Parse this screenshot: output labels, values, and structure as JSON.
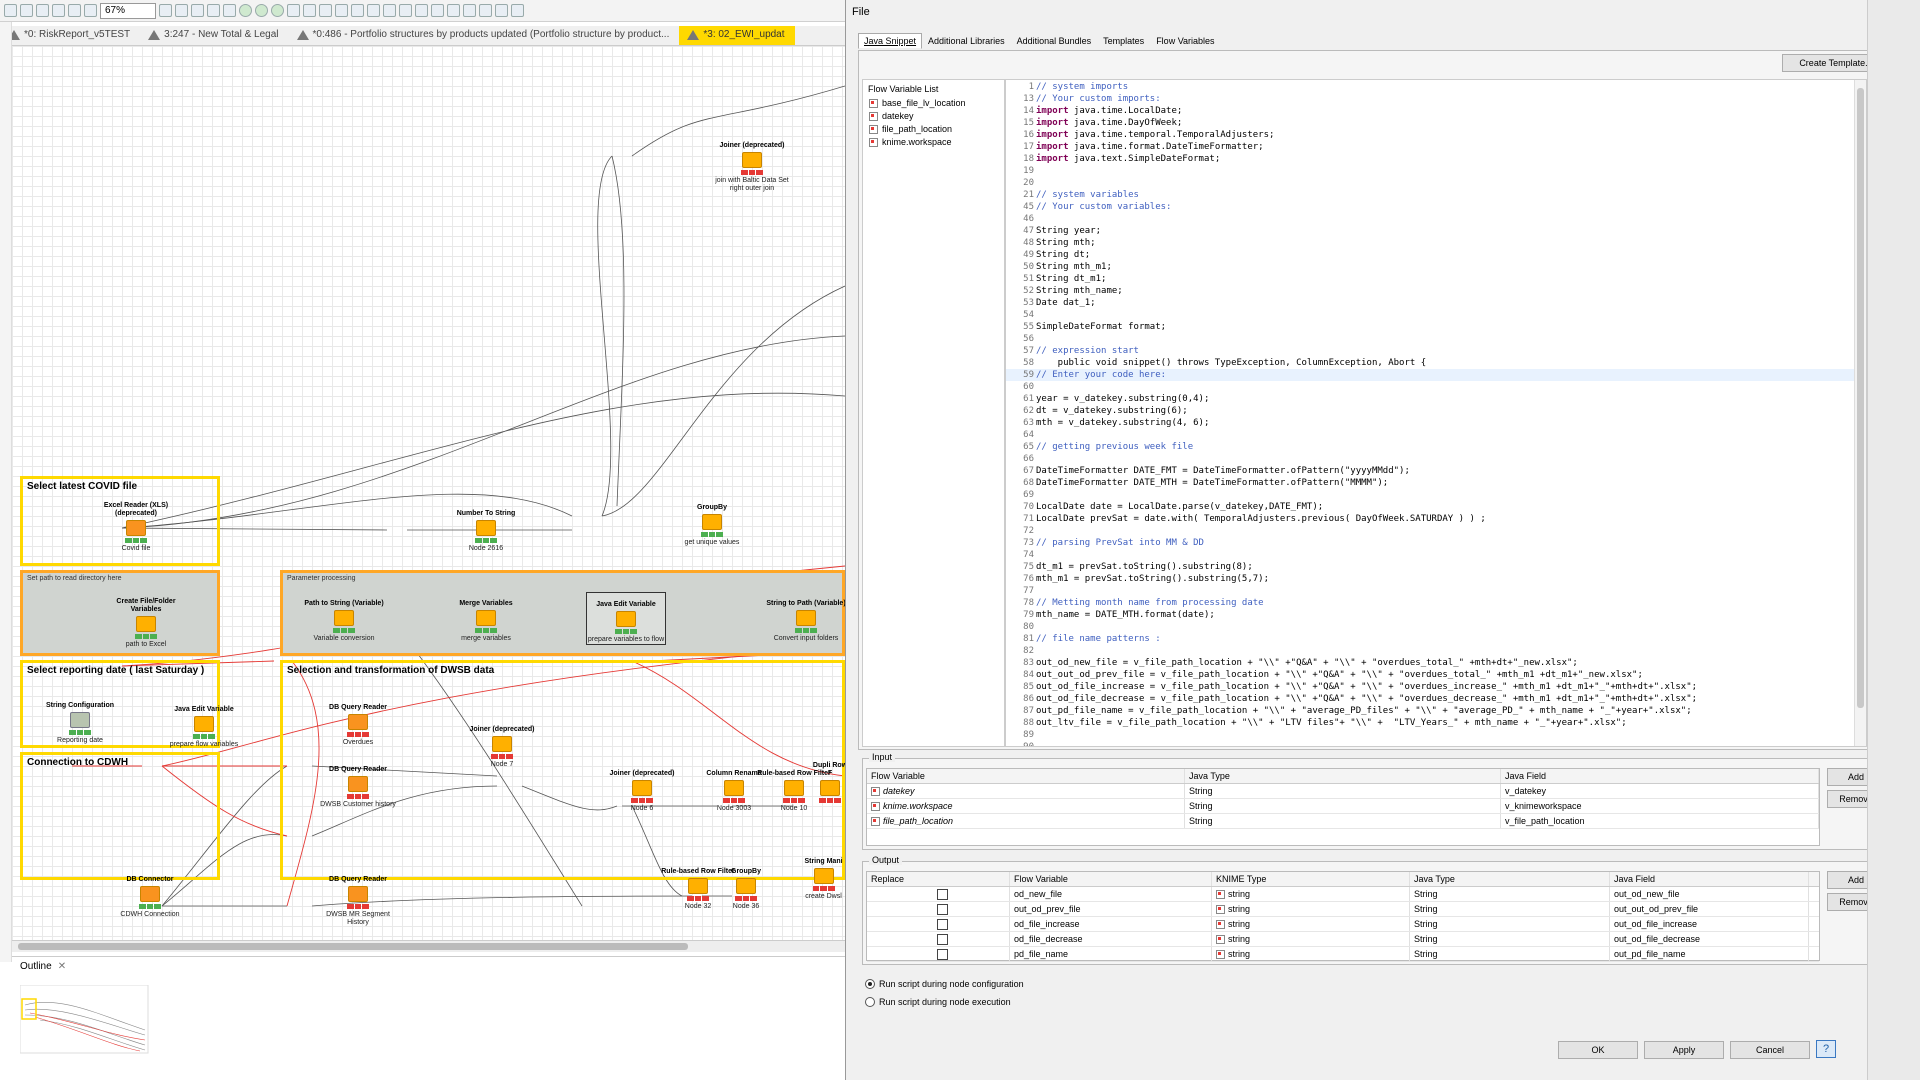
{
  "toolbar": {
    "zoom": "67%"
  },
  "editor_tabs": [
    {
      "label": "*0: RiskReport_v5TEST",
      "active": false
    },
    {
      "label": "3:247 - New Total & Legal",
      "active": false
    },
    {
      "label": "*0:486 - Portfolio structures by products updated (Portfolio structure by product...",
      "active": false
    },
    {
      "label": "*3: 02_EWI_updat",
      "active": true
    }
  ],
  "annotations": {
    "covid": "Select latest COVID file",
    "dir": "Set path to read directory here",
    "param": "Parameter processing",
    "reporting": "Select reporting date ( last Saturday )",
    "selection": "Selection and transformation of DWSB data",
    "cdwh": "Connection to CDWH"
  },
  "nodes": [
    {
      "id": "joiner-top",
      "title": "Joiner (deprecated)",
      "label": "join with Baltic Data Set right outer join"
    },
    {
      "id": "excel-reader",
      "title": "Excel Reader (XLS) (deprecated)",
      "label": "Covid file"
    },
    {
      "id": "number-to-string",
      "title": "Number To String",
      "label": "Node 2616"
    },
    {
      "id": "groupby-top",
      "title": "GroupBy",
      "label": "get unique values"
    },
    {
      "id": "create-file-folder",
      "title": "Create File/Folder Variables",
      "label": "path to Excel"
    },
    {
      "id": "path-to-string",
      "title": "Path to String (Variable)",
      "label": "Variable conversion"
    },
    {
      "id": "merge-variables",
      "title": "Merge Variables",
      "label": "merge variables"
    },
    {
      "id": "java-edit-var-top",
      "title": "Java Edit Variable",
      "label": "prepare variables to flow"
    },
    {
      "id": "string-to-path",
      "title": "String to Path (Variable)",
      "label": "Convert input folders"
    },
    {
      "id": "string-config",
      "title": "String Configuration",
      "label": "Reporting date"
    },
    {
      "id": "java-edit-var-left",
      "title": "Java Edit Variable",
      "label": "prepare flow variables"
    },
    {
      "id": "db-query-1",
      "title": "DB Query Reader",
      "label": "Overdues"
    },
    {
      "id": "joiner-mid",
      "title": "Joiner (deprecated)",
      "label": "Node 7"
    },
    {
      "id": "db-query-2",
      "title": "DB Query Reader",
      "label": "DWSB Customer history"
    },
    {
      "id": "joiner-right",
      "title": "Joiner (deprecated)",
      "label": "Node 6"
    },
    {
      "id": "column-rename",
      "title": "Column Rename",
      "label": "Node 3003"
    },
    {
      "id": "rule-row-filter",
      "title": "Rule-based Row Filter",
      "label": "Node 10"
    },
    {
      "id": "dupl",
      "title": "Dupli Row F",
      "label": ""
    },
    {
      "id": "db-connector",
      "title": "DB Connector",
      "label": "CDWH Connection"
    },
    {
      "id": "db-query-3",
      "title": "DB Query Reader",
      "label": "DWSB MR Segment History"
    },
    {
      "id": "rule-row-filter-2",
      "title": "Rule-based Row Filter",
      "label": "Node 32"
    },
    {
      "id": "groupby-bottom",
      "title": "GroupBy",
      "label": "Node 36"
    },
    {
      "id": "string-manip",
      "title": "String Mani",
      "label": "create Dwsl"
    }
  ],
  "outline": {
    "label": "Outline"
  },
  "dialog": {
    "title": "File",
    "tabs": [
      "Java Snippet",
      "Additional Libraries",
      "Additional Bundles",
      "Templates",
      "Flow Variables"
    ],
    "create_template": "Create Template...",
    "flow_variable_list": {
      "header": "Flow Variable List",
      "items": [
        "base_file_lv_location",
        "datekey",
        "file_path_location",
        "knime.workspace"
      ]
    },
    "code_lines": [
      {
        "n": "1",
        "t": "// system imports",
        "k": "cm",
        "fold": true
      },
      {
        "n": "13",
        "t": "// Your custom imports:",
        "k": "cm"
      },
      {
        "n": "14",
        "t": "import java.time.LocalDate;",
        "k": "imp"
      },
      {
        "n": "15",
        "t": "import java.time.DayOfWeek;",
        "k": "imp"
      },
      {
        "n": "16",
        "t": "import java.time.temporal.TemporalAdjusters;",
        "k": "imp"
      },
      {
        "n": "17",
        "t": "import java.time.format.DateTimeFormatter;",
        "k": "imp"
      },
      {
        "n": "18",
        "t": "import java.text.SimpleDateFormat;",
        "k": "imp"
      },
      {
        "n": "19",
        "t": "",
        "k": ""
      },
      {
        "n": "20",
        "t": "",
        "k": ""
      },
      {
        "n": "21",
        "t": "// system variables",
        "k": "cm",
        "fold": true
      },
      {
        "n": "45",
        "t": "// Your custom variables:",
        "k": "cm"
      },
      {
        "n": "46",
        "t": "",
        "k": ""
      },
      {
        "n": "47",
        "t": "String year;",
        "k": ""
      },
      {
        "n": "48",
        "t": "String mth;",
        "k": ""
      },
      {
        "n": "49",
        "t": "String dt;",
        "k": ""
      },
      {
        "n": "50",
        "t": "String mth_m1;",
        "k": ""
      },
      {
        "n": "51",
        "t": "String dt_m1;",
        "k": ""
      },
      {
        "n": "52",
        "t": "String mth_name;",
        "k": ""
      },
      {
        "n": "53",
        "t": "Date dat_1;",
        "k": ""
      },
      {
        "n": "54",
        "t": "",
        "k": ""
      },
      {
        "n": "55",
        "t": "SimpleDateFormat format;",
        "k": ""
      },
      {
        "n": "56",
        "t": "",
        "k": ""
      },
      {
        "n": "57",
        "t": "// expression start",
        "k": "cm",
        "fold": true
      },
      {
        "n": "58",
        "t": "    public void snippet() throws TypeException, ColumnException, Abort {",
        "k": ""
      },
      {
        "n": "59",
        "t": "// Enter your code here:",
        "k": "cm",
        "hl": true
      },
      {
        "n": "60",
        "t": "",
        "k": ""
      },
      {
        "n": "61",
        "t": "year = v_datekey.substring(0,4);",
        "k": ""
      },
      {
        "n": "62",
        "t": "dt = v_datekey.substring(6);",
        "k": ""
      },
      {
        "n": "63",
        "t": "mth = v_datekey.substring(4, 6);",
        "k": ""
      },
      {
        "n": "64",
        "t": "",
        "k": ""
      },
      {
        "n": "65",
        "t": "// getting previous week file",
        "k": "cm"
      },
      {
        "n": "66",
        "t": "",
        "k": ""
      },
      {
        "n": "67",
        "t": "DateTimeFormatter DATE_FMT = DateTimeFormatter.ofPattern(\"yyyyMMdd\");",
        "k": ""
      },
      {
        "n": "68",
        "t": "DateTimeFormatter DATE_MTH = DateTimeFormatter.ofPattern(\"MMMM\");",
        "k": ""
      },
      {
        "n": "69",
        "t": "",
        "k": ""
      },
      {
        "n": "70",
        "t": "LocalDate date = LocalDate.parse(v_datekey,DATE_FMT);",
        "k": ""
      },
      {
        "n": "71",
        "t": "LocalDate prevSat = date.with( TemporalAdjusters.previous( DayOfWeek.SATURDAY ) ) ;",
        "k": ""
      },
      {
        "n": "72",
        "t": "",
        "k": ""
      },
      {
        "n": "73",
        "t": "// parsing PrevSat into MM & DD",
        "k": "cm"
      },
      {
        "n": "74",
        "t": "",
        "k": ""
      },
      {
        "n": "75",
        "t": "dt_m1 = prevSat.toString().substring(8);",
        "k": ""
      },
      {
        "n": "76",
        "t": "mth_m1 = prevSat.toString().substring(5,7);",
        "k": ""
      },
      {
        "n": "77",
        "t": "",
        "k": ""
      },
      {
        "n": "78",
        "t": "// Metting month name from processing date",
        "k": "cm"
      },
      {
        "n": "79",
        "t": "mth_name = DATE_MTH.format(date);",
        "k": ""
      },
      {
        "n": "80",
        "t": "",
        "k": ""
      },
      {
        "n": "81",
        "t": "// file name patterns :",
        "k": "cm"
      },
      {
        "n": "82",
        "t": "",
        "k": ""
      },
      {
        "n": "83",
        "t": "out_od_new_file = v_file_path_location + \"\\\\\" +\"Q&A\" + \"\\\\\" + \"overdues_total_\" +mth+dt+\"_new.xlsx\";",
        "k": ""
      },
      {
        "n": "84",
        "t": "out_out_od_prev_file = v_file_path_location + \"\\\\\" +\"Q&A\" + \"\\\\\" + \"overdues_total_\" +mth_m1 +dt_m1+\"_new.xlsx\";",
        "k": ""
      },
      {
        "n": "85",
        "t": "out_od_file_increase = v_file_path_location + \"\\\\\" +\"Q&A\" + \"\\\\\" + \"overdues_increase_\" +mth_m1 +dt_m1+\"_\"+mth+dt+\".xlsx\";",
        "k": ""
      },
      {
        "n": "86",
        "t": "out_od_file_decrease = v_file_path_location + \"\\\\\" +\"Q&A\" + \"\\\\\" + \"overdues_decrease_\" +mth_m1 +dt_m1+\"_\"+mth+dt+\".xlsx\";",
        "k": ""
      },
      {
        "n": "87",
        "t": "out_pd_file_name = v_file_path_location + \"\\\\\" + \"average_PD_files\" + \"\\\\\" + \"average_PD_\" + mth_name + \"_\"+year+\".xlsx\";",
        "k": ""
      },
      {
        "n": "88",
        "t": "out_ltv_file = v_file_path_location + \"\\\\\" + \"LTV files\"+ \"\\\\\" +  \"LTV_Years_\" + mth_name + \"_\"+year+\".xlsx\";",
        "k": ""
      },
      {
        "n": "89",
        "t": "",
        "k": ""
      },
      {
        "n": "90",
        "t": "",
        "k": ""
      }
    ],
    "input": {
      "title": "Input",
      "headers": [
        "Flow Variable",
        "Java Type",
        "Java Field"
      ],
      "rows": [
        [
          "datekey",
          "String",
          "v_datekey"
        ],
        [
          "knime.workspace",
          "String",
          "v_knimeworkspace"
        ],
        [
          "file_path_location",
          "String",
          "v_file_path_location"
        ]
      ],
      "add": "Add",
      "remove": "Remove"
    },
    "output": {
      "title": "Output",
      "headers": [
        "Replace",
        "Flow Variable",
        "KNIME Type",
        "Java Type",
        "Java Field"
      ],
      "rows": [
        [
          "od_new_file",
          "string",
          "String",
          "out_od_new_file"
        ],
        [
          "out_od_prev_file",
          "string",
          "String",
          "out_out_od_prev_file"
        ],
        [
          "od_file_increase",
          "string",
          "String",
          "out_od_file_increase"
        ],
        [
          "od_file_decrease",
          "string",
          "String",
          "out_od_file_decrease"
        ],
        [
          "pd_file_name",
          "string",
          "String",
          "out_pd_file_name"
        ]
      ],
      "add": "Add",
      "remove": "Remove"
    },
    "run_options": [
      "Run script during node configuration",
      "Run script during node execution"
    ],
    "selected_run_option": 0,
    "buttons": {
      "ok": "OK",
      "apply": "Apply",
      "cancel": "Cancel",
      "help": "?"
    }
  }
}
